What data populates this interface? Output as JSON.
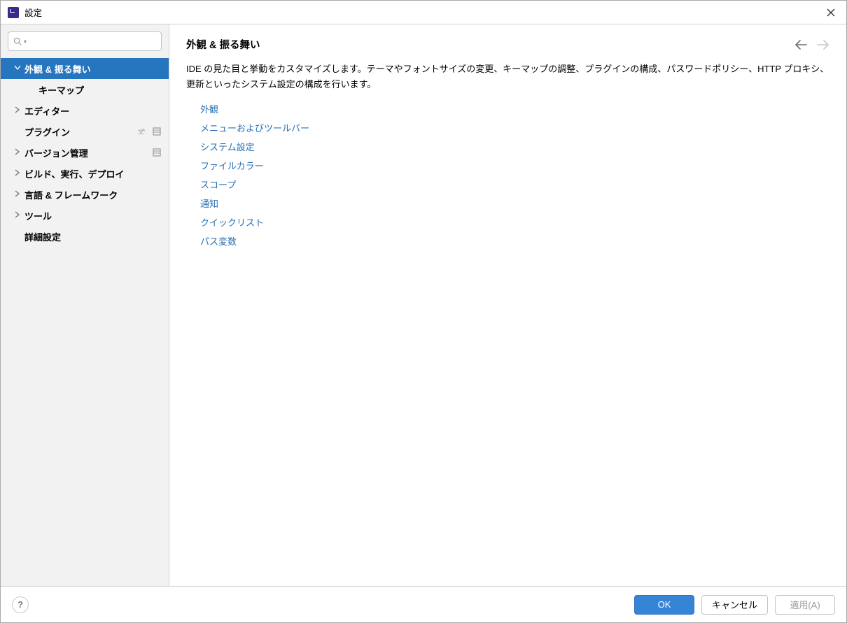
{
  "window": {
    "title": "設定"
  },
  "search": {
    "value": "",
    "placeholder": ""
  },
  "sidebar": {
    "items": [
      {
        "label": "外観 & 振る舞い",
        "expandable": true,
        "expanded": true,
        "selected": true
      },
      {
        "label": "キーマップ",
        "expandable": false,
        "child": true
      },
      {
        "label": "エディター",
        "expandable": true
      },
      {
        "label": "プラグイン",
        "expandable": false,
        "trailing": [
          "translate",
          "project"
        ]
      },
      {
        "label": "バージョン管理",
        "expandable": true,
        "trailing": [
          "project"
        ]
      },
      {
        "label": "ビルド、実行、デプロイ",
        "expandable": true
      },
      {
        "label": "言語 & フレームワーク",
        "expandable": true
      },
      {
        "label": "ツール",
        "expandable": true
      },
      {
        "label": "詳細設定",
        "expandable": false
      }
    ]
  },
  "main": {
    "heading": "外観 & 振る舞い",
    "description": "IDE の見た目と挙動をカスタマイズします。テーマやフォントサイズの変更、キーマップの調整、プラグインの構成、パスワードポリシー、HTTP プロキシ、更新といったシステム設定の構成を行います。",
    "links": [
      "外観",
      "メニューおよびツールバー",
      "システム設定",
      "ファイルカラー",
      "スコープ",
      "通知",
      "クイックリスト",
      "パス変数"
    ]
  },
  "footer": {
    "ok": "OK",
    "cancel": "キャンセル",
    "apply": "適用(A)"
  }
}
